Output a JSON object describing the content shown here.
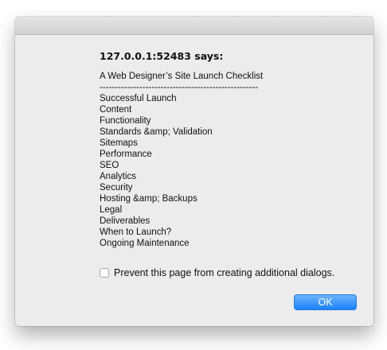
{
  "dialog": {
    "origin": "127.0.0.1:52483 says:",
    "message_lines": [
      "A Web Designer’s Site Launch Checklist",
      "----------------------------------------------------",
      "Successful Launch",
      "Content",
      "Functionality",
      "Standards &amp; Validation",
      "Sitemaps",
      "Performance",
      "SEO",
      "Analytics",
      "Security",
      "Hosting &amp; Backups",
      "Legal",
      "Deliverables",
      "When to Launch?",
      "Ongoing Maintenance"
    ],
    "prevent_label": "Prevent this page from creating additional dialogs.",
    "prevent_checked": false,
    "ok_label": "OK"
  },
  "colors": {
    "dialog_background": "#ececec",
    "button_accent": "#1a82fb"
  }
}
